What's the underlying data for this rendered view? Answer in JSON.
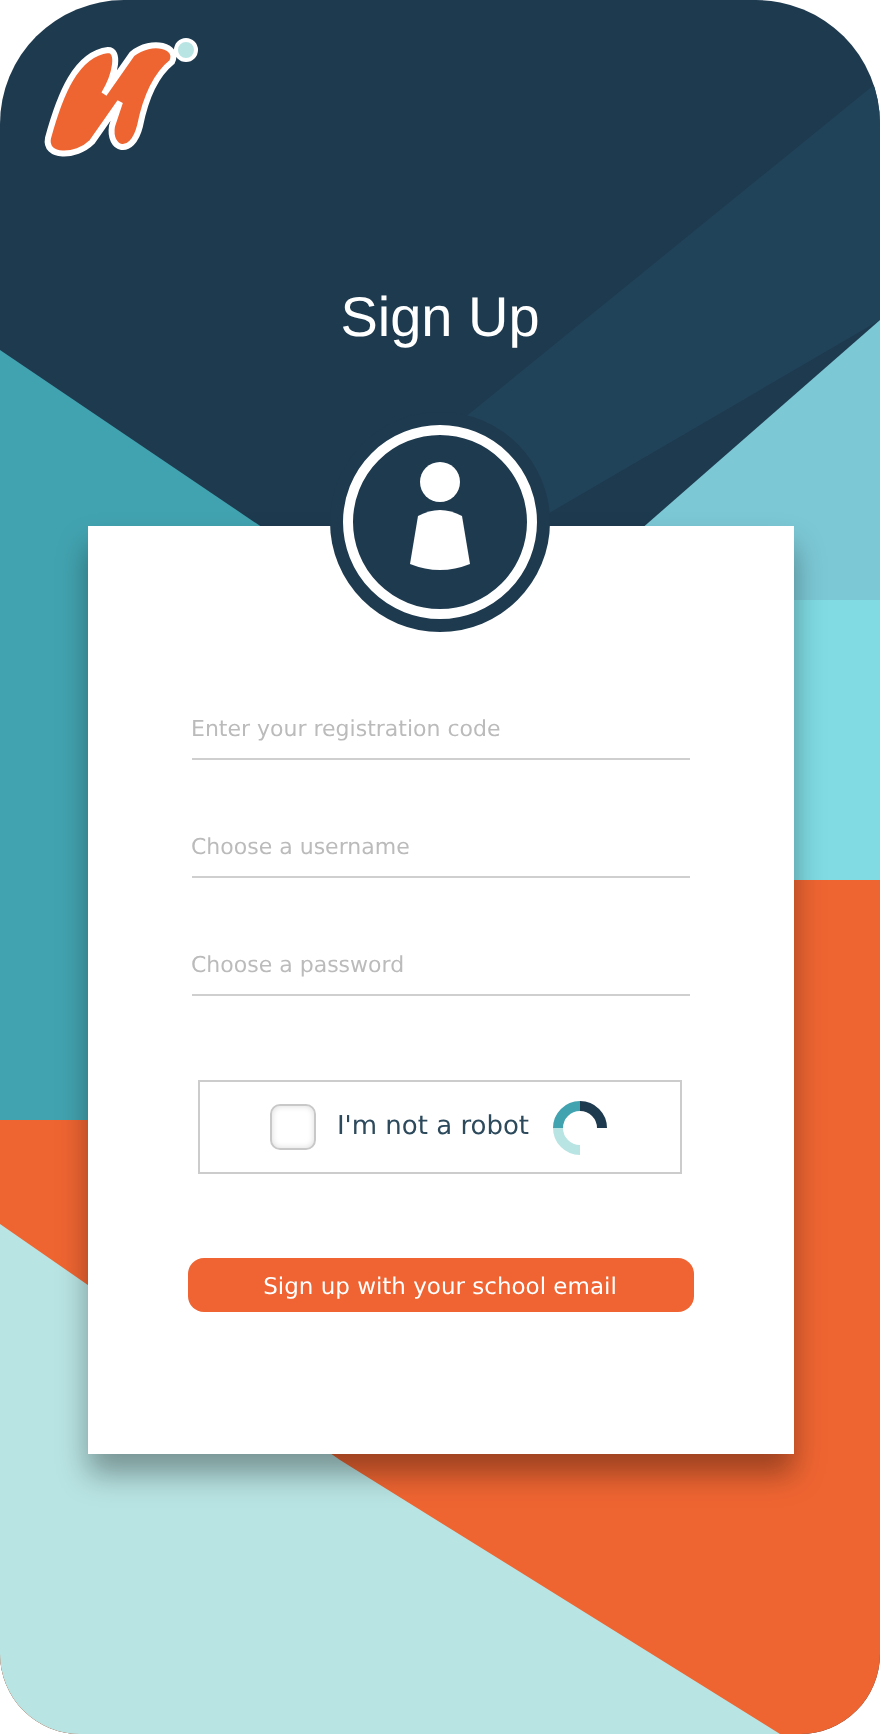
{
  "title": "Sign Up",
  "fields": [
    {
      "placeholder": "Enter your registration code"
    },
    {
      "placeholder": "Choose a username"
    },
    {
      "placeholder": "Choose a password"
    }
  ],
  "captcha": {
    "label": "I'm not a robot",
    "checked": false
  },
  "submit": {
    "label": "Sign up with your school email"
  }
}
